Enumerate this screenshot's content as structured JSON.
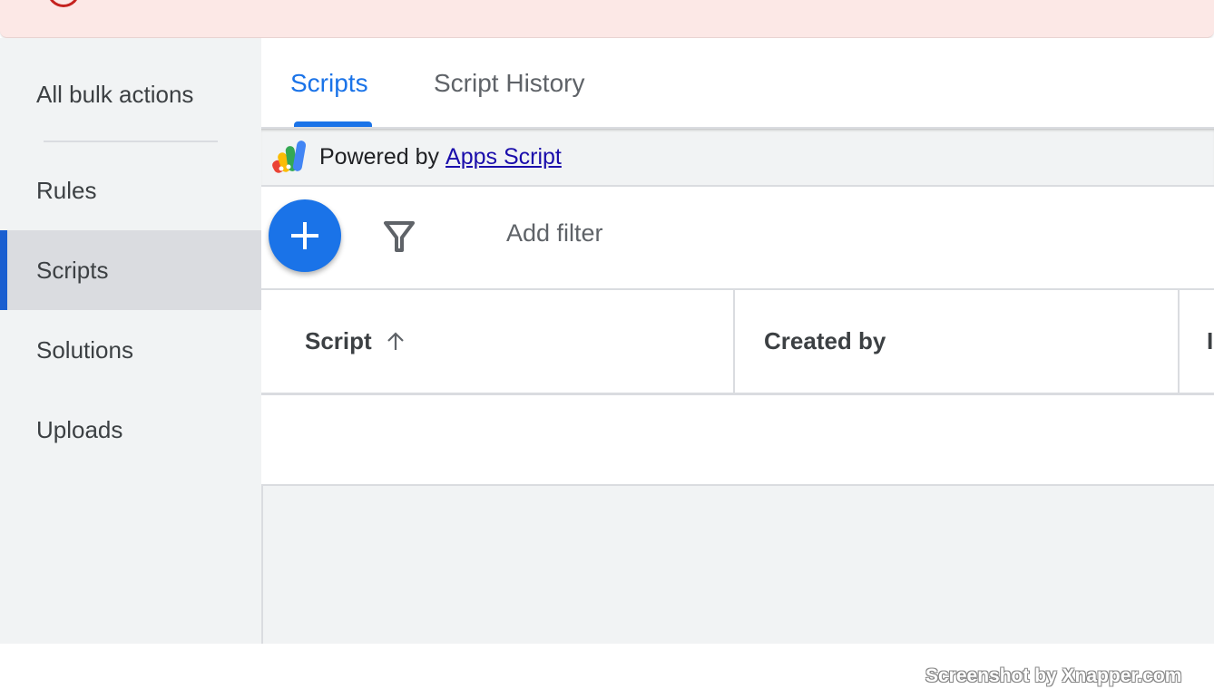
{
  "sidebar": {
    "items": [
      {
        "label": "All bulk actions"
      },
      {
        "label": "Rules"
      },
      {
        "label": "Scripts"
      },
      {
        "label": "Solutions"
      },
      {
        "label": "Uploads"
      }
    ]
  },
  "tabs": [
    {
      "label": "Scripts"
    },
    {
      "label": "Script History"
    }
  ],
  "powered": {
    "prefix": "Powered by",
    "link": "Apps Script"
  },
  "toolbar": {
    "add_filter": "Add filter"
  },
  "table": {
    "columns": [
      {
        "label": "Script",
        "sort": "ascending"
      },
      {
        "label": "Created by"
      },
      {
        "label": "I"
      }
    ]
  },
  "watermark": "Screenshot by Xnapper.com",
  "colors": {
    "accent": "#1a73e8",
    "active_indicator": "#1a5fd0",
    "alert_bg": "#fce8e6",
    "alert_icon": "#c5221f"
  }
}
